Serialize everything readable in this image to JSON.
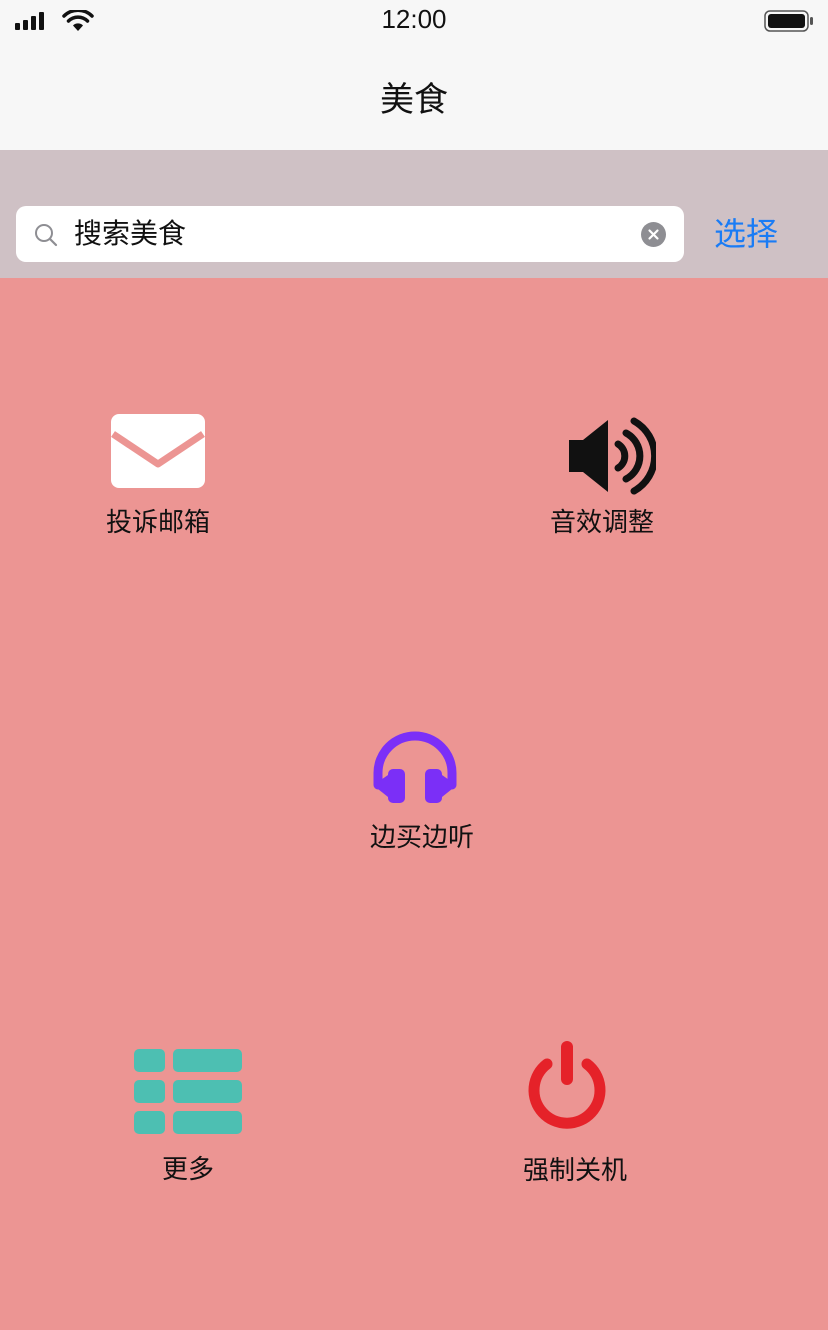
{
  "status_bar": {
    "time": "12:00",
    "icons": [
      "signal-icon",
      "wifi-icon",
      "battery-icon"
    ]
  },
  "nav": {
    "title": "美食"
  },
  "search": {
    "placeholder": "搜索美食",
    "value": "搜索美食",
    "icon": "search-icon",
    "clear_icon": "clear-icon",
    "select_label": "选择"
  },
  "grid": {
    "mail": {
      "label": "投诉邮箱",
      "icon": "envelope-icon",
      "color": "#FFFFFF"
    },
    "sound": {
      "label": "音效调整",
      "icon": "speaker-icon",
      "color": "#111111"
    },
    "listen": {
      "label": "边买边听",
      "icon": "headphones-icon",
      "color": "#7B2FF7"
    },
    "more": {
      "label": "更多",
      "icon": "list-icon",
      "color": "#4DBFB2"
    },
    "shutdown": {
      "label": "强制关机",
      "icon": "power-icon",
      "color": "#E52229"
    }
  },
  "colors": {
    "background": "#EC9593",
    "search_bar_bg": "#CFC1C5",
    "nav_bg": "#F7F7F7",
    "accent": "#1A7CF5"
  }
}
